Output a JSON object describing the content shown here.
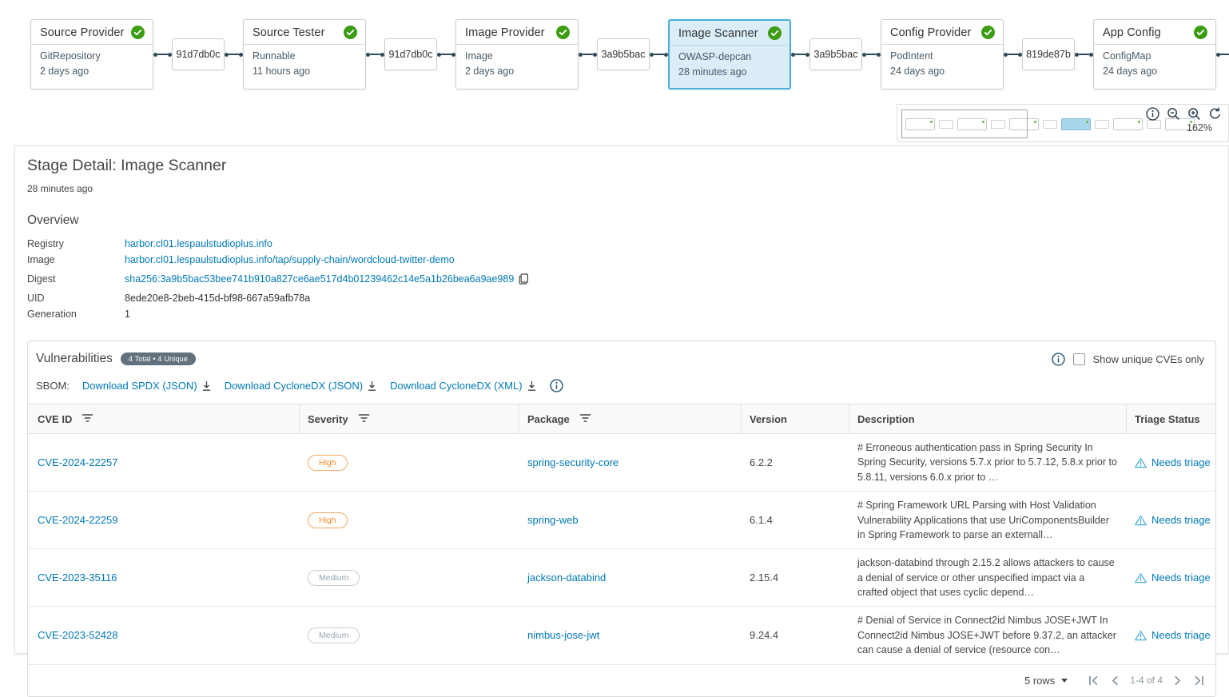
{
  "pipeline": {
    "stages": [
      {
        "name": "Source Provider",
        "resource": "GitRepository",
        "time": "2 days ago",
        "status": "succeeded"
      },
      {
        "name": "Source Tester",
        "resource": "Runnable",
        "time": "11 hours ago",
        "status": "succeeded"
      },
      {
        "name": "Image Provider",
        "resource": "Image",
        "time": "2 days ago",
        "status": "succeeded"
      },
      {
        "name": "Image Scanner",
        "resource": "OWASP-depcan",
        "time": "28 minutes ago",
        "status": "succeeded",
        "selected": true
      },
      {
        "name": "Config Provider",
        "resource": "PodIntent",
        "time": "24 days ago",
        "status": "succeeded"
      },
      {
        "name": "App Config",
        "resource": "ConfigMap",
        "time": "24 days ago",
        "status": "succeeded"
      }
    ],
    "artifacts": [
      "91d7db0c",
      "91d7db0c",
      "3a9b5bac",
      "3a9b5bac",
      "819de87b"
    ]
  },
  "minimap": {
    "zoom_level": "162%"
  },
  "stage_detail": {
    "title": "Stage Detail: Image Scanner",
    "timestamp": "28 minutes ago",
    "overview": {
      "heading": "Overview",
      "registry_label": "Registry",
      "registry": "harbor.cl01.lespaulstudioplus.info",
      "image_label": "Image",
      "image": "harbor.cl01.lespaulstudioplus.info/tap/supply-chain/wordcloud-twitter-demo",
      "digest_label": "Digest",
      "digest": "sha256:3a9b5bac53bee741b910a827ce6ae517d4b01239462c14e5a1b26bea6a9ae989",
      "uid_label": "UID",
      "uid": "8ede20e8-2beb-415d-bf98-667a59afb78a",
      "generation_label": "Generation",
      "generation": "1"
    }
  },
  "vulnerabilities": {
    "heading": "Vulnerabilities",
    "badge": "4 Total • 4 Unique",
    "show_unique_label": "Show unique CVEs only",
    "sbom_label": "SBOM:",
    "downloads": [
      {
        "label": "Download SPDX (JSON)"
      },
      {
        "label": "Download CycloneDX (JSON)"
      },
      {
        "label": "Download CycloneDX (XML)"
      }
    ],
    "table": {
      "columns": {
        "cve": "CVE ID",
        "severity": "Severity",
        "package": "Package",
        "version": "Version",
        "description": "Description",
        "triage": "Triage Status"
      },
      "rows": [
        {
          "cve": "CVE-2024-22257",
          "severity": "High",
          "package": "spring-security-core",
          "version": "6.2.2",
          "description": "# Erroneous authentication pass in Spring Security In Spring Security, versions 5.7.x prior to 5.7.12, 5.8.x prior to 5.8.11, versions 6.0.x prior to …",
          "triage": "Needs triage"
        },
        {
          "cve": "CVE-2024-22259",
          "severity": "High",
          "package": "spring-web",
          "version": "6.1.4",
          "description": "# Spring Framework URL Parsing with Host Validation Vulnerability Applications that use UriComponentsBuilder in Spring Framework to parse an externall…",
          "triage": "Needs triage"
        },
        {
          "cve": "CVE-2023-35116",
          "severity": "Medium",
          "package": "jackson-databind",
          "version": "2.15.4",
          "description": "jackson-databind through 2.15.2 allows attackers to cause a denial of service or other unspecified impact via a crafted object that uses cyclic depend…",
          "triage": "Needs triage"
        },
        {
          "cve": "CVE-2023-52428",
          "severity": "Medium",
          "package": "nimbus-jose-jwt",
          "version": "9.24.4",
          "description": "# Denial of Service in Connect2id Nimbus JOSE+JWT In Connect2id Nimbus JOSE+JWT before 9.37.2, an attacker can cause a denial of service (resource con…",
          "triage": "Needs triage"
        }
      ]
    },
    "pagination": {
      "rows_per_page": "5 rows",
      "range": "1-4 of 4"
    }
  },
  "colors": {
    "accent_blue": "#49afd9",
    "link_blue": "#0079b8",
    "success_green": "#3c9c13",
    "high_orange": "#f08c2e",
    "medium_gray": "#96a5b3",
    "badge_slate": "#61717d",
    "connector": "#2e4a5a"
  }
}
